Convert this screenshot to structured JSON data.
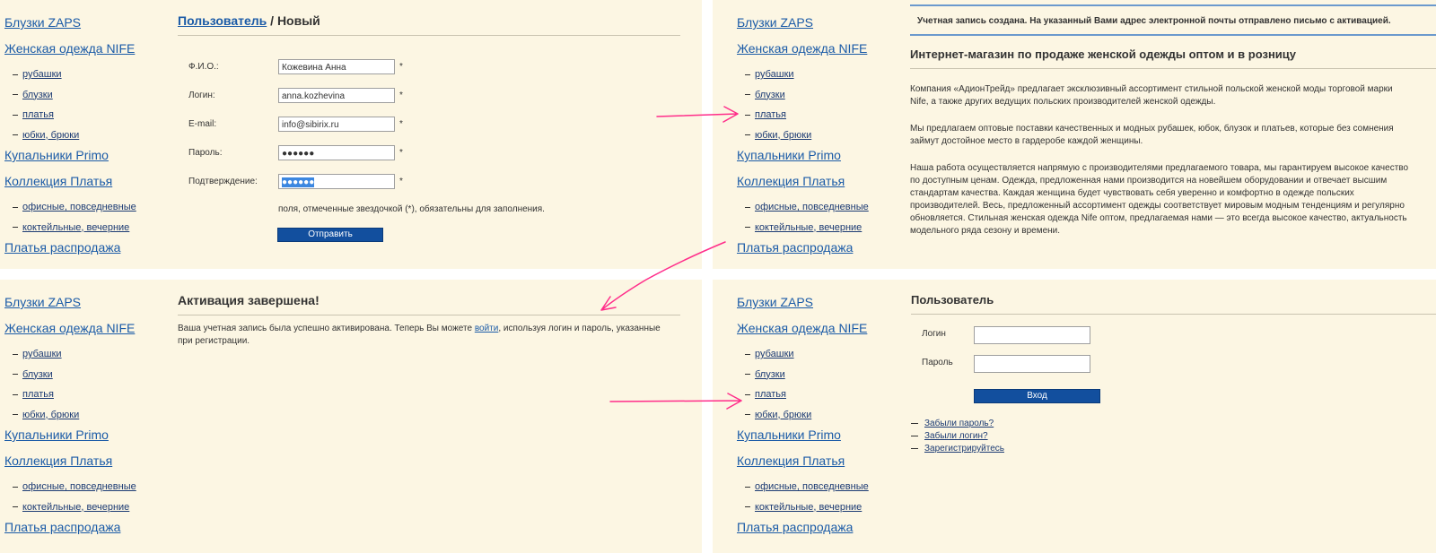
{
  "nav": {
    "cat1": "Блузки ZAPS",
    "cat2": "Женская одежда NIFE",
    "sub2": [
      "рубашки",
      "блузки",
      "платья",
      "юбки, брюки"
    ],
    "cat3": "Купальники Primo",
    "cat4": "Коллекция Платья",
    "sub4": [
      "офисные, повседневные",
      "коктейльные, вечерние"
    ],
    "cat5": "Платья распродажа"
  },
  "register": {
    "title_link": "Пользователь",
    "title_rest": " / Новый",
    "fields": [
      {
        "label": "Ф.И.О.:",
        "value": "Кожевина Анна"
      },
      {
        "label": "Логин:",
        "value": "anna.kozhevina"
      },
      {
        "label": "E-mail:",
        "value": "info@sibirix.ru"
      },
      {
        "label": "Пароль:",
        "value": "●●●●●●"
      },
      {
        "label": "Подтверждение:",
        "value": "●●●●●●"
      }
    ],
    "required_star": "*",
    "note": "поля, отмеченные звездочкой (*), обязательны для заполнения.",
    "submit": "Отправить"
  },
  "created": {
    "message": "Учетная запись создана. На указанный Вами адрес электронной почты отправлено письмо с активацией.",
    "heading": "Интернет-магазин по продаже женской одежды оптом и в розницу",
    "p1": "Компания «АдионТрейд» предлагает эксклюзивный ассортимент стильной польской женской моды торговой марки Nife, а также других ведущих польских производителей женской одежды.",
    "p2": "Мы предлагаем оптовые поставки качественных и модных рубашек, юбок, блузок и платьев, которые без сомнения займут достойное место в гардеробе каждой женщины.",
    "p3": "Наша работа осуществляется напрямую с производителями предлагаемого товара, мы гарантируем высокое качество по доступным ценам. Одежда, предложенная нами производится на новейшем оборудовании и отвечает высшим стандартам качества. Каждая женщина будет чувствовать себя уверенно и комфортно в одежде польских производителей. Весь, предложенный ассортимент одежды соответствует мировым модным тенденциям и регулярно обновляется. Стильная женская одежда Nife оптом, предлагаемая нами — это всегда высокое качество, актуальность модельного ряда сезону и времени."
  },
  "activated": {
    "heading": "Активация завершена!",
    "text_before": "Ваша учетная запись была успешно активирована. Теперь Вы можете ",
    "link": "войти",
    "text_after": ", используя логин и пароль, указанные при регистрации."
  },
  "login": {
    "heading": "Пользователь",
    "login_label": "Логин",
    "password_label": "Пароль",
    "login_value": "",
    "password_value": "",
    "submit": "Вход",
    "links": [
      "Забыли пароль?",
      "Забыли логин?",
      "Зарегистрируйтесь"
    ]
  },
  "colors": {
    "arrow": "#ff2d8a",
    "button": "#124f9e",
    "link": "#1b5ba7",
    "panel_bg": "#fcf6e3"
  }
}
